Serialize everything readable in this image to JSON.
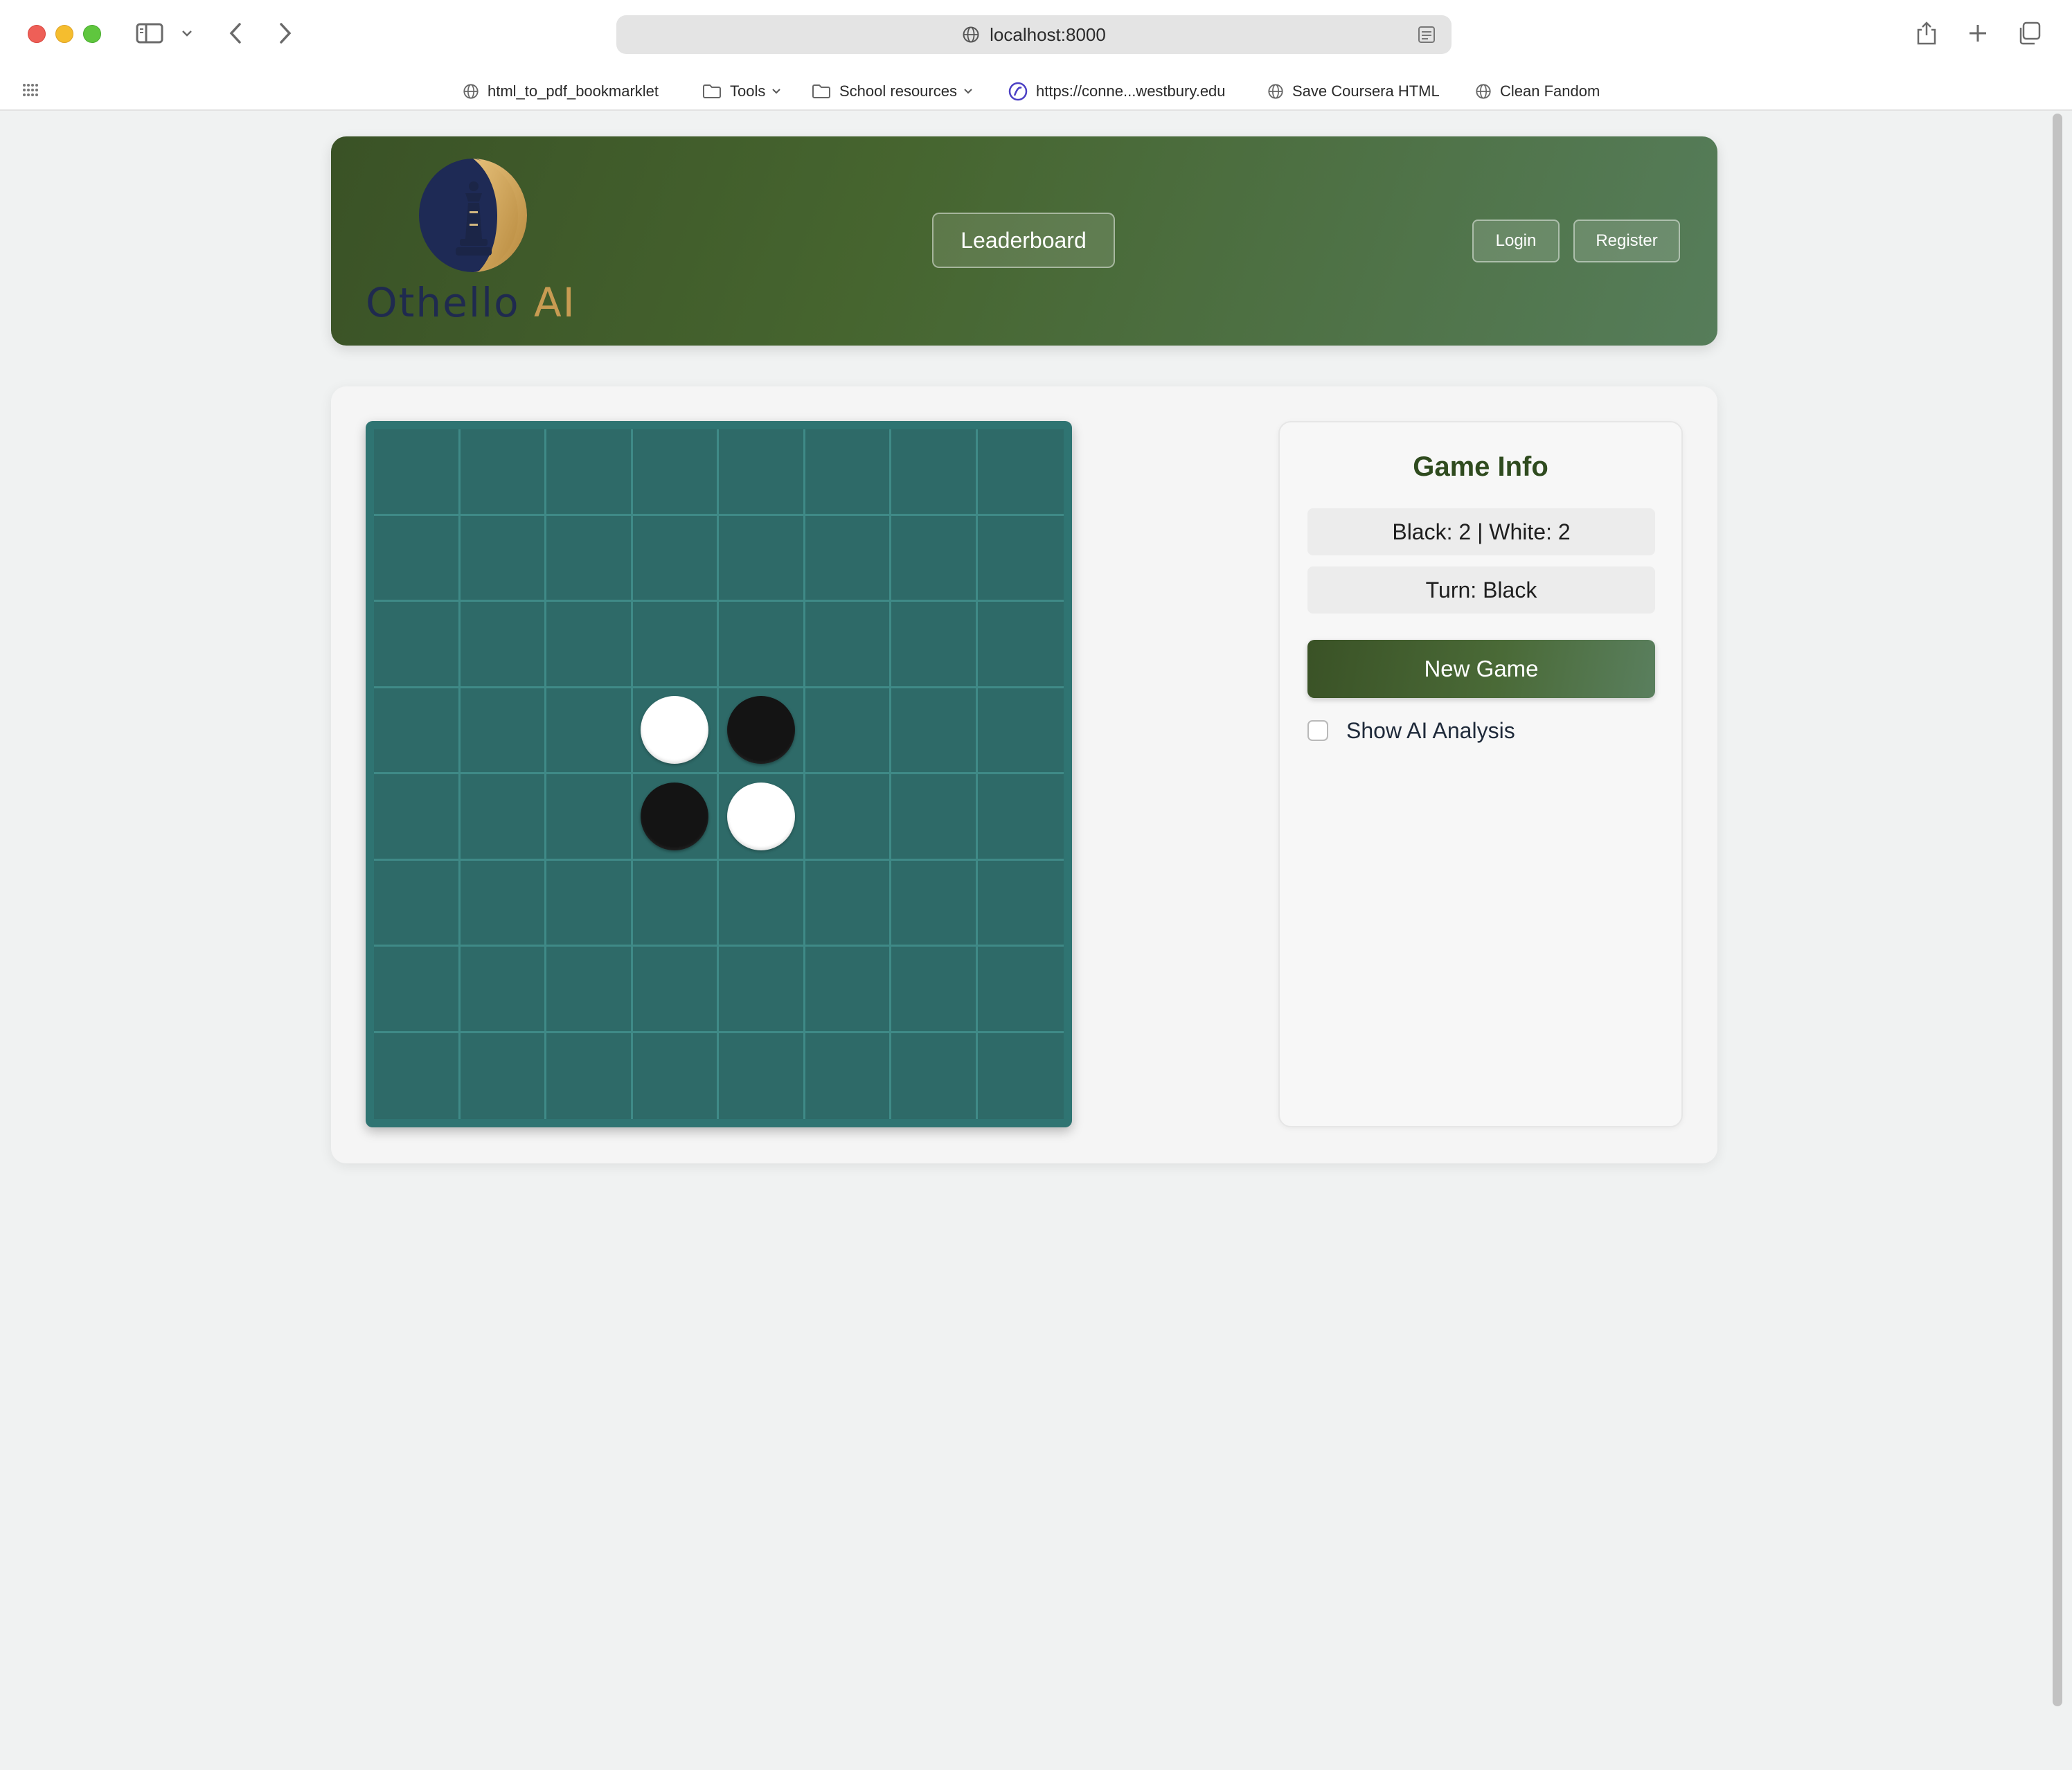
{
  "browser": {
    "url": "localhost:8000",
    "bookmarks": [
      {
        "label": "html_to_pdf_bookmarklet",
        "icon": "globe-icon"
      },
      {
        "label": "Tools",
        "icon": "folder-icon",
        "has_menu": true
      },
      {
        "label": "School resources",
        "icon": "folder-icon",
        "has_menu": true
      },
      {
        "label": "https://conne...westbury.edu",
        "icon": "site-favicon"
      },
      {
        "label": "Save Coursera HTML",
        "icon": "globe-icon"
      },
      {
        "label": "Clean Fandom",
        "icon": "globe-icon"
      }
    ]
  },
  "header": {
    "logo_text_main": "Othello",
    "logo_text_accent": "AI",
    "leaderboard_label": "Leaderboard",
    "login_label": "Login",
    "register_label": "Register"
  },
  "game": {
    "board": [
      [
        0,
        0,
        0,
        0,
        0,
        0,
        0,
        0
      ],
      [
        0,
        0,
        0,
        0,
        0,
        0,
        0,
        0
      ],
      [
        0,
        0,
        0,
        0,
        0,
        0,
        0,
        0
      ],
      [
        0,
        0,
        0,
        2,
        1,
        0,
        0,
        0
      ],
      [
        0,
        0,
        0,
        1,
        2,
        0,
        0,
        0
      ],
      [
        0,
        0,
        0,
        0,
        0,
        0,
        0,
        0
      ],
      [
        0,
        0,
        0,
        0,
        0,
        0,
        0,
        0
      ],
      [
        0,
        0,
        0,
        0,
        0,
        0,
        0,
        0
      ]
    ],
    "board_legend": {
      "0": "empty",
      "1": "black",
      "2": "white"
    },
    "info_title": "Game Info",
    "score_text": "Black: 2 | White: 2",
    "turn_text": "Turn: Black",
    "new_game_label": "New Game",
    "ai_analysis_label": "Show AI Analysis",
    "ai_analysis_checked": false
  },
  "colors": {
    "header_dark": "#3a5226",
    "header_light": "#567d5a",
    "board_green": "#2e6a68",
    "grid_line": "#3f8a87",
    "logo_navy": "#1f2a4f",
    "logo_gold": "#c89b52"
  }
}
